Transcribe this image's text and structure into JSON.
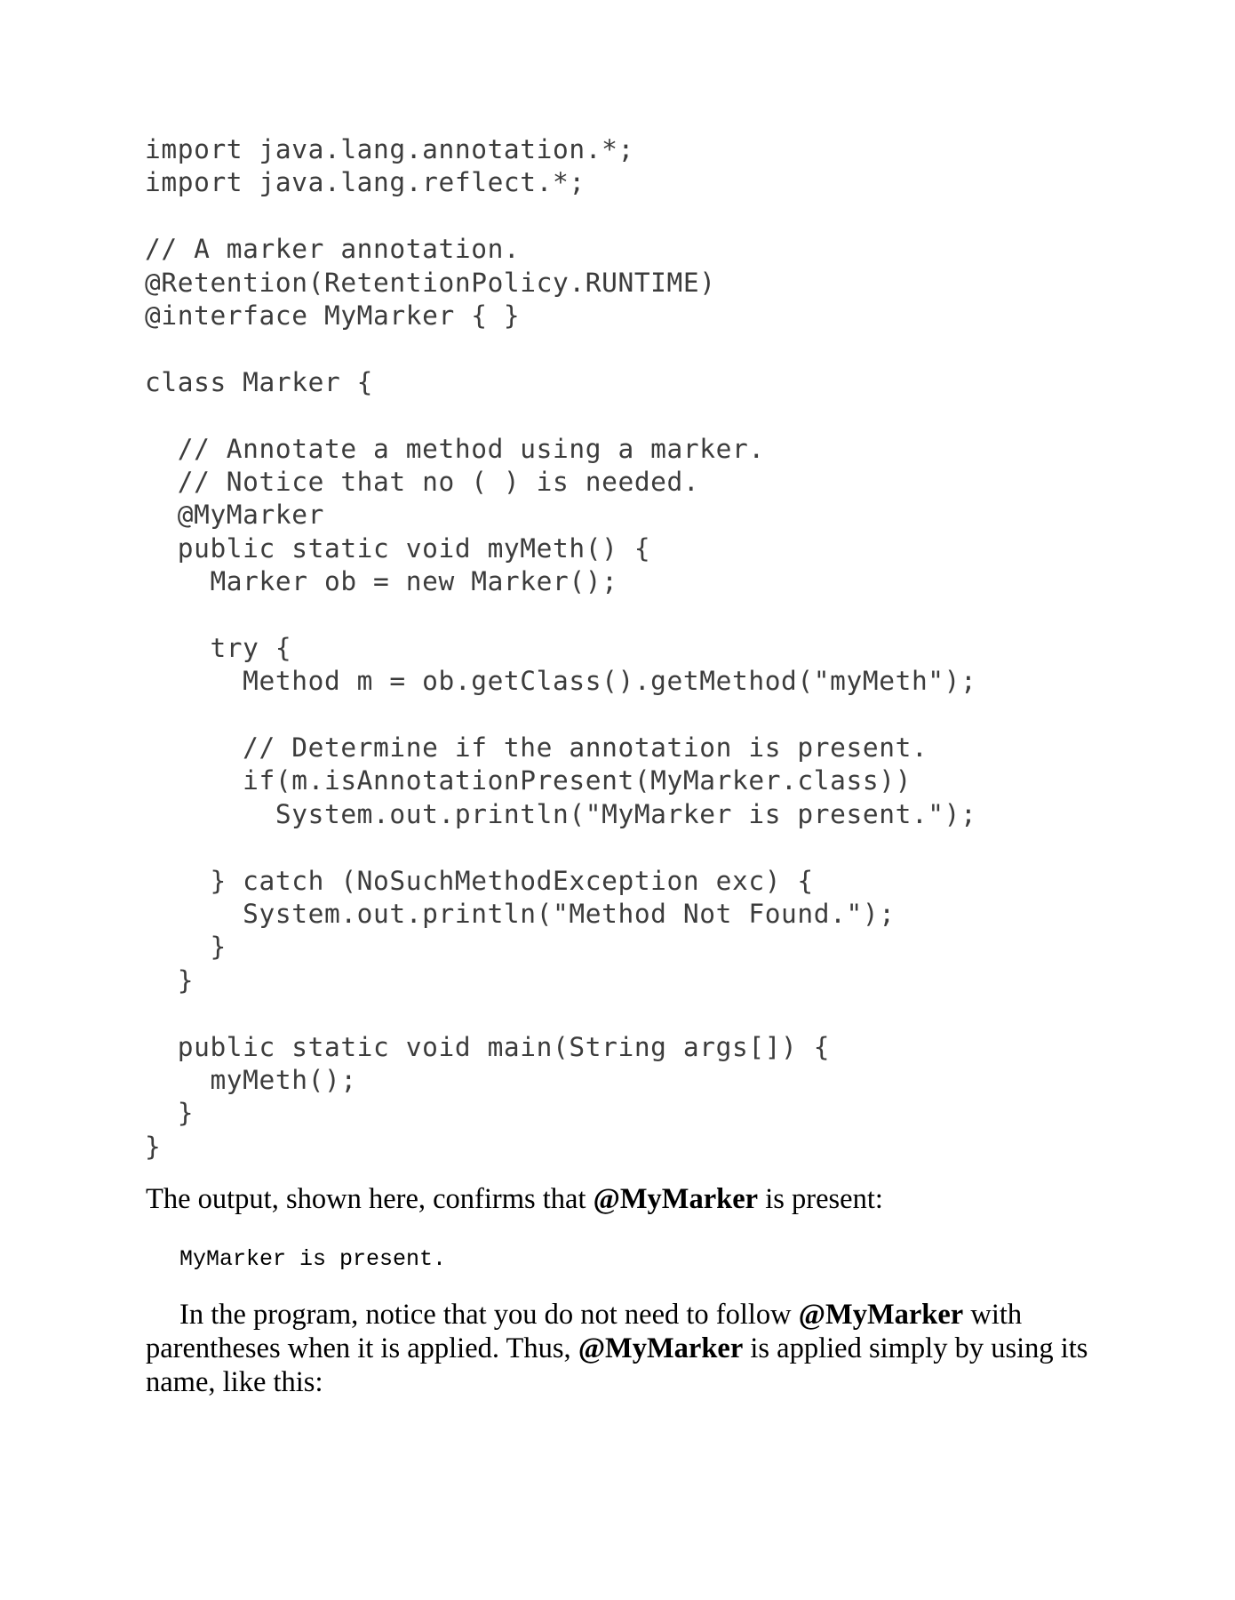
{
  "code_listing": {
    "lines": [
      "import java.lang.annotation.*;",
      "import java.lang.reflect.*;",
      "",
      "// A marker annotation.",
      "@Retention(RetentionPolicy.RUNTIME)",
      "@interface MyMarker { }",
      "",
      "class Marker {",
      "",
      "  // Annotate a method using a marker.",
      "  // Notice that no ( ) is needed.",
      "  @MyMarker",
      "  public static void myMeth() {",
      "    Marker ob = new Marker();",
      "",
      "    try {",
      "      Method m = ob.getClass().getMethod(\"myMeth\");",
      "",
      "      // Determine if the annotation is present.",
      "      if(m.isAnnotationPresent(MyMarker.class))",
      "        System.out.println(\"MyMarker is present.\");",
      "",
      "    } catch (NoSuchMethodException exc) {",
      "      System.out.println(\"Method Not Found.\");",
      "    }",
      "  }",
      "",
      "  public static void main(String args[]) {",
      "    myMeth();",
      "  }",
      "}"
    ]
  },
  "output_paragraph": {
    "before": "The output, shown here, confirms that ",
    "bold": "@MyMarker",
    "after": " is present:"
  },
  "output_code": "MyMarker is present.",
  "explain_paragraph": {
    "part1": "In the program, notice that you do not need to follow ",
    "bold1": "@MyMarker",
    "part2": " with parentheses when it is applied. Thus, ",
    "bold2": "@MyMarker",
    "part3": " is applied simply by using its name, like this:"
  }
}
